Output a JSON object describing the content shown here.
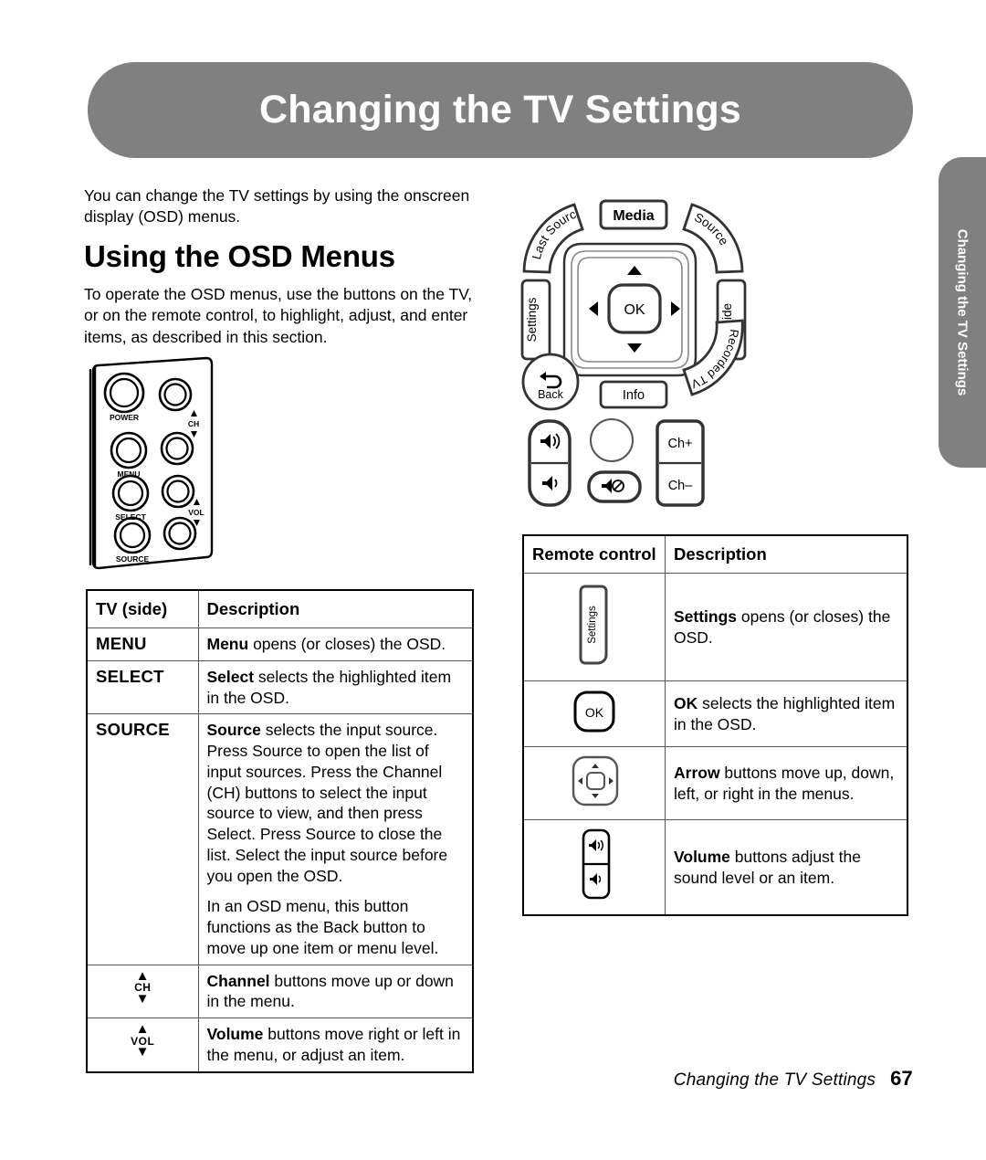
{
  "document": {
    "banner_title": "Changing the TV Settings",
    "side_tab_label": "Changing the TV Settings",
    "accent_gray": "#808080",
    "footer": {
      "text": "Changing the TV Settings",
      "page_number": "67"
    }
  },
  "body": {
    "intro": "You can change the TV settings by using the onscreen display (OSD) menus.",
    "heading": "Using the OSD Menus",
    "intro2": "To operate the OSD menus, use the buttons on the TV, or on the remote control, to highlight, adjust, and enter items, as described in this section."
  },
  "tv_panel_diagram": {
    "labels": [
      "POWER",
      "MENU",
      "SELECT",
      "SOURCE",
      "CH",
      "VOL"
    ]
  },
  "remote_diagram": {
    "media": "Media",
    "last_source": "Last Source",
    "source": "Source",
    "settings": "Settings",
    "guide": "Guide",
    "back": "Back",
    "info": "Info",
    "recorded_tv": "Recorded TV",
    "ok": "OK",
    "ch_up": "Ch+",
    "ch_down": "Ch–"
  },
  "tv_table": {
    "headers": [
      "TV (side)",
      "Description"
    ],
    "rows": [
      {
        "key": "MENU",
        "icon": null,
        "paragraphs": [
          {
            "lead": "Menu",
            "rest": " opens (or closes) the OSD."
          }
        ]
      },
      {
        "key": "SELECT",
        "icon": null,
        "paragraphs": [
          {
            "lead": "Select",
            "rest": " selects the highlighted item in the OSD."
          }
        ]
      },
      {
        "key": "SOURCE",
        "icon": null,
        "paragraphs": [
          {
            "lead": "Source",
            "rest": " selects the input source. Press Source to open the list of input sources. Press the Channel (CH) buttons to select the input source to view, and then press Select. Press Source to close the list. Select the input source before you open the OSD."
          },
          {
            "lead": "",
            "rest": "In an OSD menu, this button functions as the Back button to move up one item or menu level."
          }
        ]
      },
      {
        "key": "",
        "icon": "CH",
        "paragraphs": [
          {
            "lead": "Channel",
            "rest": " buttons move up or down in the menu."
          }
        ]
      },
      {
        "key": "",
        "icon": "VOL",
        "paragraphs": [
          {
            "lead": "Volume",
            "rest": " buttons move right or left in the menu, or adjust an item."
          }
        ]
      }
    ]
  },
  "remote_table": {
    "headers": [
      "Remote control",
      "Description"
    ],
    "rows": [
      {
        "icon_name": "settings-key-icon",
        "icon_label": "Settings",
        "paragraphs": [
          {
            "lead": "Settings",
            "rest": " opens (or closes) the OSD."
          }
        ]
      },
      {
        "icon_name": "ok-key-icon",
        "icon_label": "OK",
        "paragraphs": [
          {
            "lead": "OK",
            "rest": " selects the highlighted item in the OSD."
          }
        ]
      },
      {
        "icon_name": "arrow-pad-icon",
        "icon_label": "",
        "paragraphs": [
          {
            "lead": "Arrow",
            "rest": " buttons move up, down, left, or right in the menus."
          }
        ]
      },
      {
        "icon_name": "volume-rocker-icon",
        "icon_label": "",
        "paragraphs": [
          {
            "lead": "Volume",
            "rest": " buttons adjust the sound level or an item."
          }
        ]
      }
    ]
  }
}
